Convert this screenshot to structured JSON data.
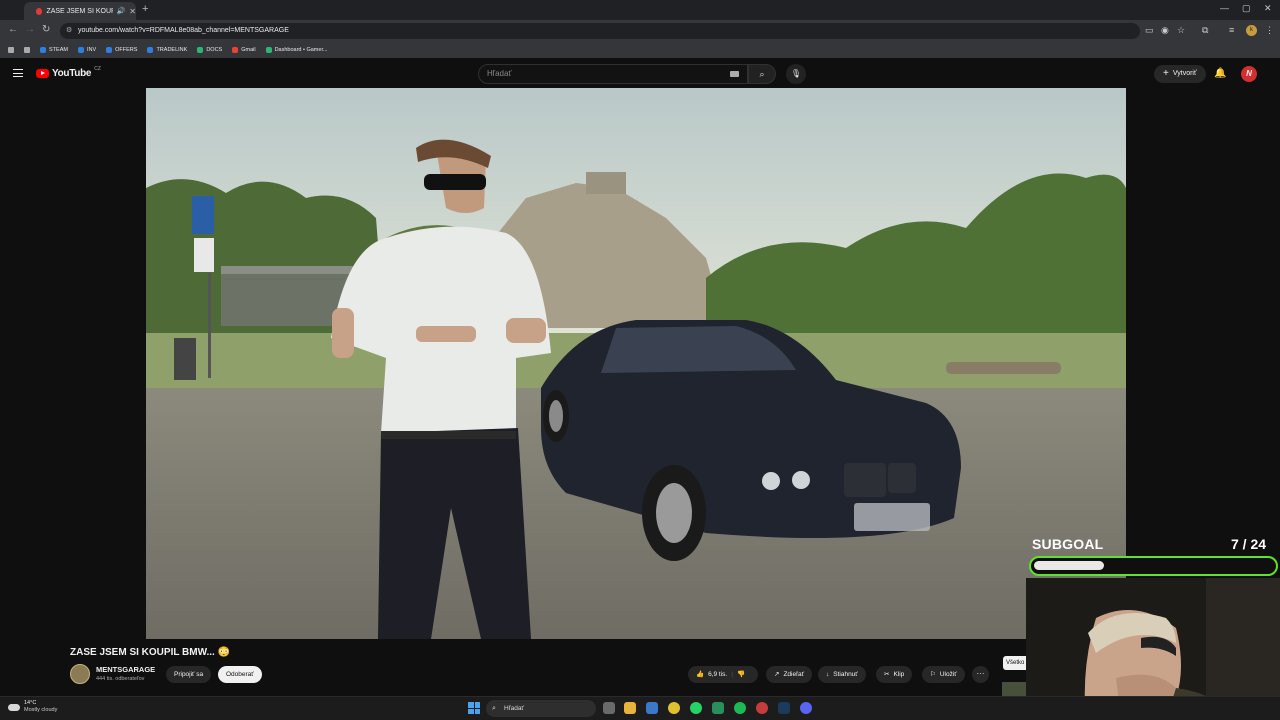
{
  "browser": {
    "tab_title": "ZASE JSEM SI KOUPIL BMW...",
    "tab_close": "✕",
    "new_tab": "+",
    "url": "youtube.com/watch?v=RDFMAL8e08ab_channel=MENTSGARAGE",
    "bookmarks": [
      "STEAM",
      "INV",
      "OFFERS",
      "TRADELINK",
      "DOCS",
      "Gmail",
      "Dashboard • Gamer..."
    ],
    "window_controls": [
      "—",
      "▢",
      "✕"
    ]
  },
  "youtube": {
    "logo_text": "YouTube",
    "country_code": "CZ",
    "search_placeholder": "Hľadať",
    "create_label": "Vytvoriť",
    "avatar_letter": "N"
  },
  "video": {
    "title": "ZASE JSEM SI KOUPIL BMW... 😳",
    "channel_name": "MENTSGARAGE",
    "channel_subs": "444 tis. odberateľov",
    "join_label": "Pripojiť sa",
    "subscribe_label": "Odoberať",
    "like_count": "6,9 tis.",
    "share_label": "Zdieľať",
    "download_label": "Stiahnuť",
    "clip_label": "Klip",
    "save_label": "Uložiť",
    "more_label": "···",
    "sidebar_chip": "Všetko"
  },
  "overlay": {
    "subgoal_label": "SUBGOAL",
    "current": 7,
    "target": 24,
    "count_text": "7  / 24",
    "bar_color": "#5ce32a"
  },
  "taskbar": {
    "temperature": "14°C",
    "weather": "Mostly cloudy",
    "search_label": "Hľadať"
  }
}
